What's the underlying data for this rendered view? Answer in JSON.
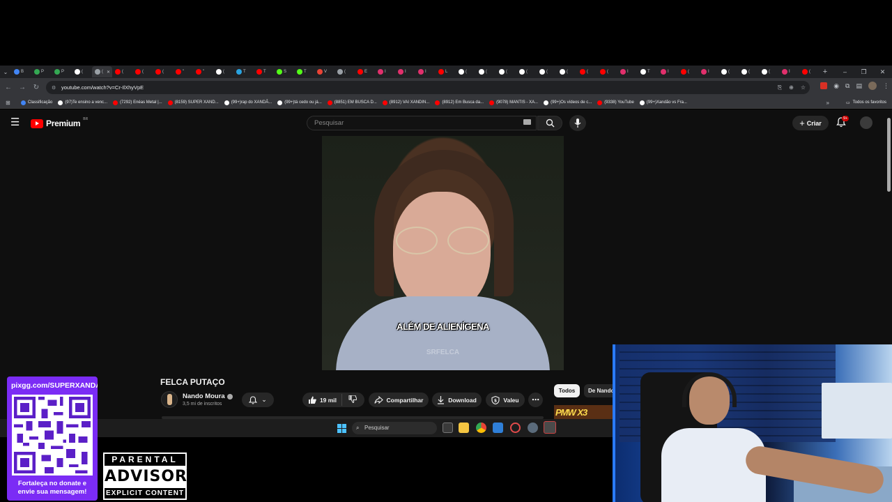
{
  "browser": {
    "tabs": [
      {
        "glyph": "B",
        "color": "#4285f4"
      },
      {
        "glyph": "P",
        "color": "#34a853"
      },
      {
        "glyph": "P",
        "color": "#34a853"
      },
      {
        "glyph": "(",
        "color": "#ffffff"
      },
      {
        "glyph": "(",
        "color": "#9aa0a6",
        "active": true
      },
      {
        "glyph": "(",
        "color": "#ff0000"
      },
      {
        "glyph": "(",
        "color": "#ff0000"
      },
      {
        "glyph": "(",
        "color": "#ff0000"
      },
      {
        "glyph": "\"",
        "color": "#ff0000"
      },
      {
        "glyph": "\"",
        "color": "#ff0000"
      },
      {
        "glyph": "(",
        "color": "#ffffff"
      },
      {
        "glyph": "T",
        "color": "#2aa3df"
      },
      {
        "glyph": "T",
        "color": "#ff0000"
      },
      {
        "glyph": "S",
        "color": "#53fc18"
      },
      {
        "glyph": "T",
        "color": "#53fc18"
      },
      {
        "glyph": "V",
        "color": "#ea4335"
      },
      {
        "glyph": "(",
        "color": "#9aa0a6"
      },
      {
        "glyph": "E",
        "color": "#ff0000"
      },
      {
        "glyph": "I",
        "color": "#e1306c"
      },
      {
        "glyph": "I",
        "color": "#e1306c"
      },
      {
        "glyph": "I",
        "color": "#e1306c"
      },
      {
        "glyph": "L",
        "color": "#ff0000"
      },
      {
        "glyph": "(",
        "color": "#ffffff"
      },
      {
        "glyph": "(",
        "color": "#ffffff"
      },
      {
        "glyph": "(",
        "color": "#ffffff"
      },
      {
        "glyph": "(",
        "color": "#ffffff"
      },
      {
        "glyph": "(",
        "color": "#ffffff"
      },
      {
        "glyph": "(",
        "color": "#ffffff"
      },
      {
        "glyph": "(",
        "color": "#ff0000"
      },
      {
        "glyph": "(",
        "color": "#ff0000"
      },
      {
        "glyph": "I",
        "color": "#e1306c"
      },
      {
        "glyph": "T",
        "color": "#ffffff"
      },
      {
        "glyph": "I",
        "color": "#e1306c"
      },
      {
        "glyph": "(",
        "color": "#ff0000"
      },
      {
        "glyph": "I",
        "color": "#e1306c"
      },
      {
        "glyph": "(",
        "color": "#ffffff"
      },
      {
        "glyph": "(",
        "color": "#ffffff"
      },
      {
        "glyph": "(",
        "color": "#ffffff"
      },
      {
        "glyph": "I",
        "color": "#e1306c"
      },
      {
        "glyph": "(",
        "color": "#ff0000"
      }
    ],
    "url": "youtube.com/watch?v=Cr-IlXhyVpE",
    "bookmarks": [
      {
        "label": "Classificação",
        "color": "#4285f4"
      },
      {
        "label": "(97)Te ensino a venc...",
        "color": "#ffffff"
      },
      {
        "label": "(7292) Enéas Metal |...",
        "color": "#ff0000"
      },
      {
        "label": "(8159) SUPER XAND...",
        "color": "#ff0000"
      },
      {
        "label": "(99+)rap do XANDÃ...",
        "color": "#ffffff"
      },
      {
        "label": "(99+)tá cedo ou já...",
        "color": "#ffffff"
      },
      {
        "label": "(8851) EM BUSCA D...",
        "color": "#ff0000"
      },
      {
        "label": "(8912) VAI XANDIN...",
        "color": "#ff0000"
      },
      {
        "label": "(8912) Em Busca da...",
        "color": "#ff0000"
      },
      {
        "label": "(9078) MANTIS - XA...",
        "color": "#ff0000"
      },
      {
        "label": "(99+)Os vídeos de c...",
        "color": "#ffffff"
      },
      {
        "label": "(9338) YouTube",
        "color": "#ff0000"
      },
      {
        "label": "(99+)Xandão vs Fra...",
        "color": "#ffffff"
      }
    ],
    "all_bookmarks_label": "Todos os favoritos"
  },
  "youtube": {
    "logo_text": "Premium",
    "logo_region": "BR",
    "search_placeholder": "Pesquisar",
    "create_label": "Criar",
    "notification_badge": "9+",
    "video": {
      "caption": "ALÉM DE ALIENÍGENA",
      "watermark": "SRFELCA",
      "title": "FELCA PUTAÇO"
    },
    "channel": {
      "name": "Nando Moura",
      "subscribers": "3,5 mi de inscritos"
    },
    "actions": {
      "likes": "19 mil",
      "share": "Compartilhar",
      "download": "Download",
      "thanks": "Valeu",
      "more": "⋯"
    },
    "chips": [
      "Todos",
      "De Nando"
    ],
    "thumb_text": "PMW X3"
  },
  "taskbar": {
    "search_placeholder": "Pesquisar"
  },
  "overlays": {
    "donate_url": "pixgg.com/SUPERXANDA",
    "donate_message_line1": "Fortaleça no donate e",
    "donate_message_line2": "envie sua mensagem!",
    "advisory_top": "PARENTAL",
    "advisory_mid": "ADVISORY",
    "advisory_bottom": "EXPLICIT CONTENT"
  }
}
